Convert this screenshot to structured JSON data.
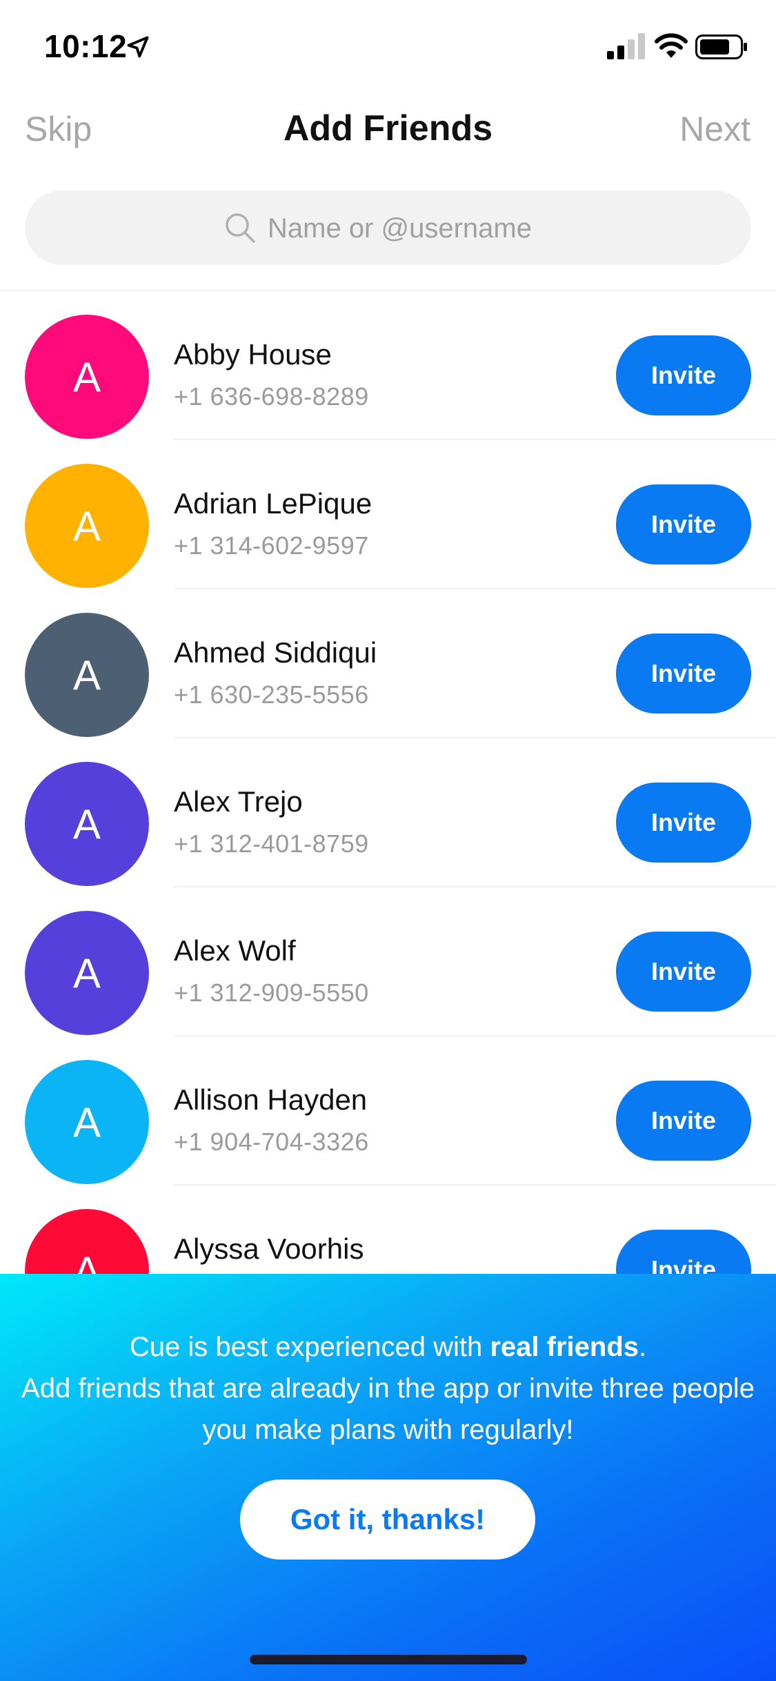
{
  "status_bar": {
    "time": "10:12"
  },
  "nav": {
    "skip": "Skip",
    "title": "Add Friends",
    "next": "Next"
  },
  "search": {
    "placeholder": "Name or @username",
    "value": ""
  },
  "contacts": [
    {
      "initial": "A",
      "name": "Abby House",
      "phone": "+1 636-698-8289",
      "color": "#ff0a7a",
      "action": "Invite"
    },
    {
      "initial": "A",
      "name": "Adrian LePique",
      "phone": "+1 314-602-9597",
      "color": "#ffb300",
      "action": "Invite"
    },
    {
      "initial": "A",
      "name": "Ahmed Siddiqui",
      "phone": "+1 630-235-5556",
      "color": "#4d6073",
      "action": "Invite"
    },
    {
      "initial": "A",
      "name": "Alex Trejo",
      "phone": "+1 312-401-8759",
      "color": "#5540dc",
      "action": "Invite"
    },
    {
      "initial": "A",
      "name": "Alex Wolf",
      "phone": "+1 312-909-5550",
      "color": "#5540dc",
      "action": "Invite"
    },
    {
      "initial": "A",
      "name": "Allison Hayden",
      "phone": "+1 904-704-3326",
      "color": "#0ab4f5",
      "action": "Invite"
    },
    {
      "initial": "A",
      "name": "Alyssa Voorhis",
      "phone": "",
      "color": "#ff0a36",
      "action": "Invite"
    }
  ],
  "banner": {
    "line1_pre": "Cue is best experienced with ",
    "line1_bold": "real friends",
    "line1_post": ".",
    "line2": "Add friends that are already in the app or invite three people you make plans with regularly!",
    "button": "Got it, thanks!"
  },
  "colors": {
    "accent": "#0a7af2",
    "muted": "#a7a7a7"
  },
  "icons": [
    "location-arrow-icon",
    "signal-icon",
    "wifi-icon",
    "battery-icon",
    "search-icon"
  ]
}
